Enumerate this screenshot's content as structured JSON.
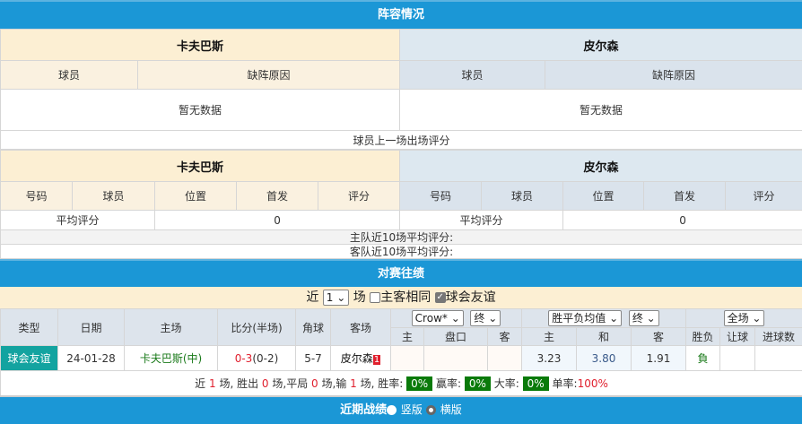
{
  "lineup": {
    "title": "阵容情况",
    "home": "卡夫巴斯",
    "away": "皮尔森",
    "col_player": "球员",
    "col_reason": "缺阵原因",
    "no_data": "暂无数据",
    "rating_title": "球员上一场出场评分",
    "rating_cols": [
      "号码",
      "球员",
      "位置",
      "首发",
      "评分"
    ],
    "avg_label": "平均评分",
    "home_avg": "0",
    "away_avg": "0",
    "home_recent": "主队近10场平均评分:",
    "away_recent": "客队近10场平均评分:"
  },
  "h2h": {
    "title": "对赛往绩",
    "near": "近",
    "count": "1",
    "games": "场",
    "same_home": "主客相同",
    "same_home_checked": false,
    "friendly": "球会友谊",
    "friendly_checked": true,
    "headers": {
      "type": "类型",
      "date": "日期",
      "home": "主场",
      "score": "比分(半场)",
      "corner": "角球",
      "away": "客场",
      "company": "Crow*",
      "final1": "终",
      "odds_type": "胜平负均值",
      "final2": "终",
      "scope": "全场",
      "h": "主",
      "line": "盘口",
      "a": "客",
      "h2": "主",
      "d": "和",
      "a2": "客",
      "result": "胜负",
      "handicap": "让球",
      "goals": "进球数"
    },
    "rows": [
      {
        "type": "球会友谊",
        "date": "24-01-28",
        "home": "卡夫巴斯(中)",
        "score_ft": "0-3",
        "score_ht": "(0-2)",
        "corner": "5-7",
        "away": "皮尔森",
        "away_badge": "1",
        "oh": "",
        "line": "",
        "oa": "",
        "w": "3.23",
        "d": "3.80",
        "l": "1.91",
        "result": "負",
        "handicap": "",
        "goals": ""
      }
    ],
    "summary": {
      "near": "近",
      "games": "1",
      "s1": "场, 胜出",
      "win": "0",
      "s2": "场,平局",
      "draw": "0",
      "s3": "场,输",
      "lose": "1",
      "s4": "场, 胜率:",
      "win_rate": "0%",
      "s5": "赢率:",
      "ying_rate": "0%",
      "s6": "大率:",
      "big_rate": "0%",
      "s7": "单率:",
      "odd_rate": "100%"
    }
  },
  "recent": {
    "title": "近期战绩",
    "vertical": "竖版",
    "horizontal": "横版",
    "selected": "横版"
  },
  "colors": {
    "bar": "#1b97d6",
    "home_bg": "#fcefd3",
    "away_bg": "#dde8f0",
    "type_bg": "#13a3a0",
    "pill": "#0a7a0a"
  }
}
